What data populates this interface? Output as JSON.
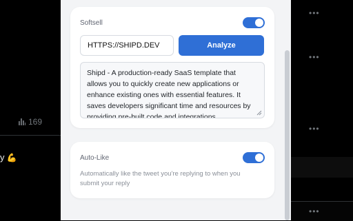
{
  "background_feed": {
    "view_count": "169",
    "tweet_tail_text": "y",
    "tweet_tail_emoji": "💪",
    "more_glyph": "•••"
  },
  "softsell": {
    "title": "Softsell",
    "toggle_on": true,
    "url_value": "HTTPS://SHIPD.DEV",
    "analyze_label": "Analyze",
    "description": "Shipd - A production-ready SaaS template that allows you to quickly create new applications or enhance existing ones with essential features. It saves developers significant time and resources by providing pre-built code and integrations."
  },
  "autolike": {
    "title": "Auto-Like",
    "toggle_on": true,
    "description": "Automatically like the tweet you're replying to when you submit your reply"
  },
  "colors": {
    "accent": "#2f6fd6",
    "panel_bg": "#f3f4f6",
    "card_bg": "#ffffff",
    "feed_bg": "#000000"
  }
}
